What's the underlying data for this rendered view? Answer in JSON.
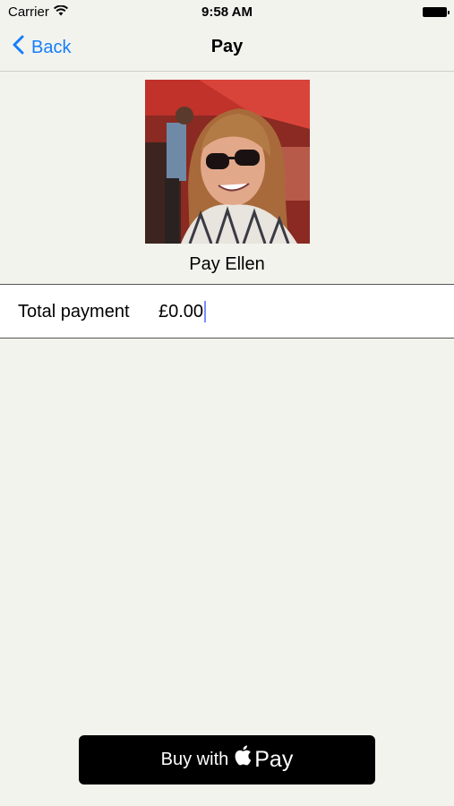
{
  "status_bar": {
    "carrier": "Carrier",
    "time": "9:58 AM",
    "wifi_icon": "wifi-icon",
    "battery_icon": "battery-full-icon"
  },
  "nav": {
    "back_label": "Back",
    "title": "Pay",
    "back_icon": "chevron-left-icon",
    "accent_color": "#157efb"
  },
  "payee": {
    "name": "Pay Ellen"
  },
  "payment": {
    "label": "Total payment",
    "value": "£0.00"
  },
  "buy_button": {
    "prefix": "Buy with",
    "pay": "Pay",
    "icon": "apple-logo-icon"
  },
  "colors": {
    "background": "#f3f3ee",
    "button": "#000000"
  }
}
